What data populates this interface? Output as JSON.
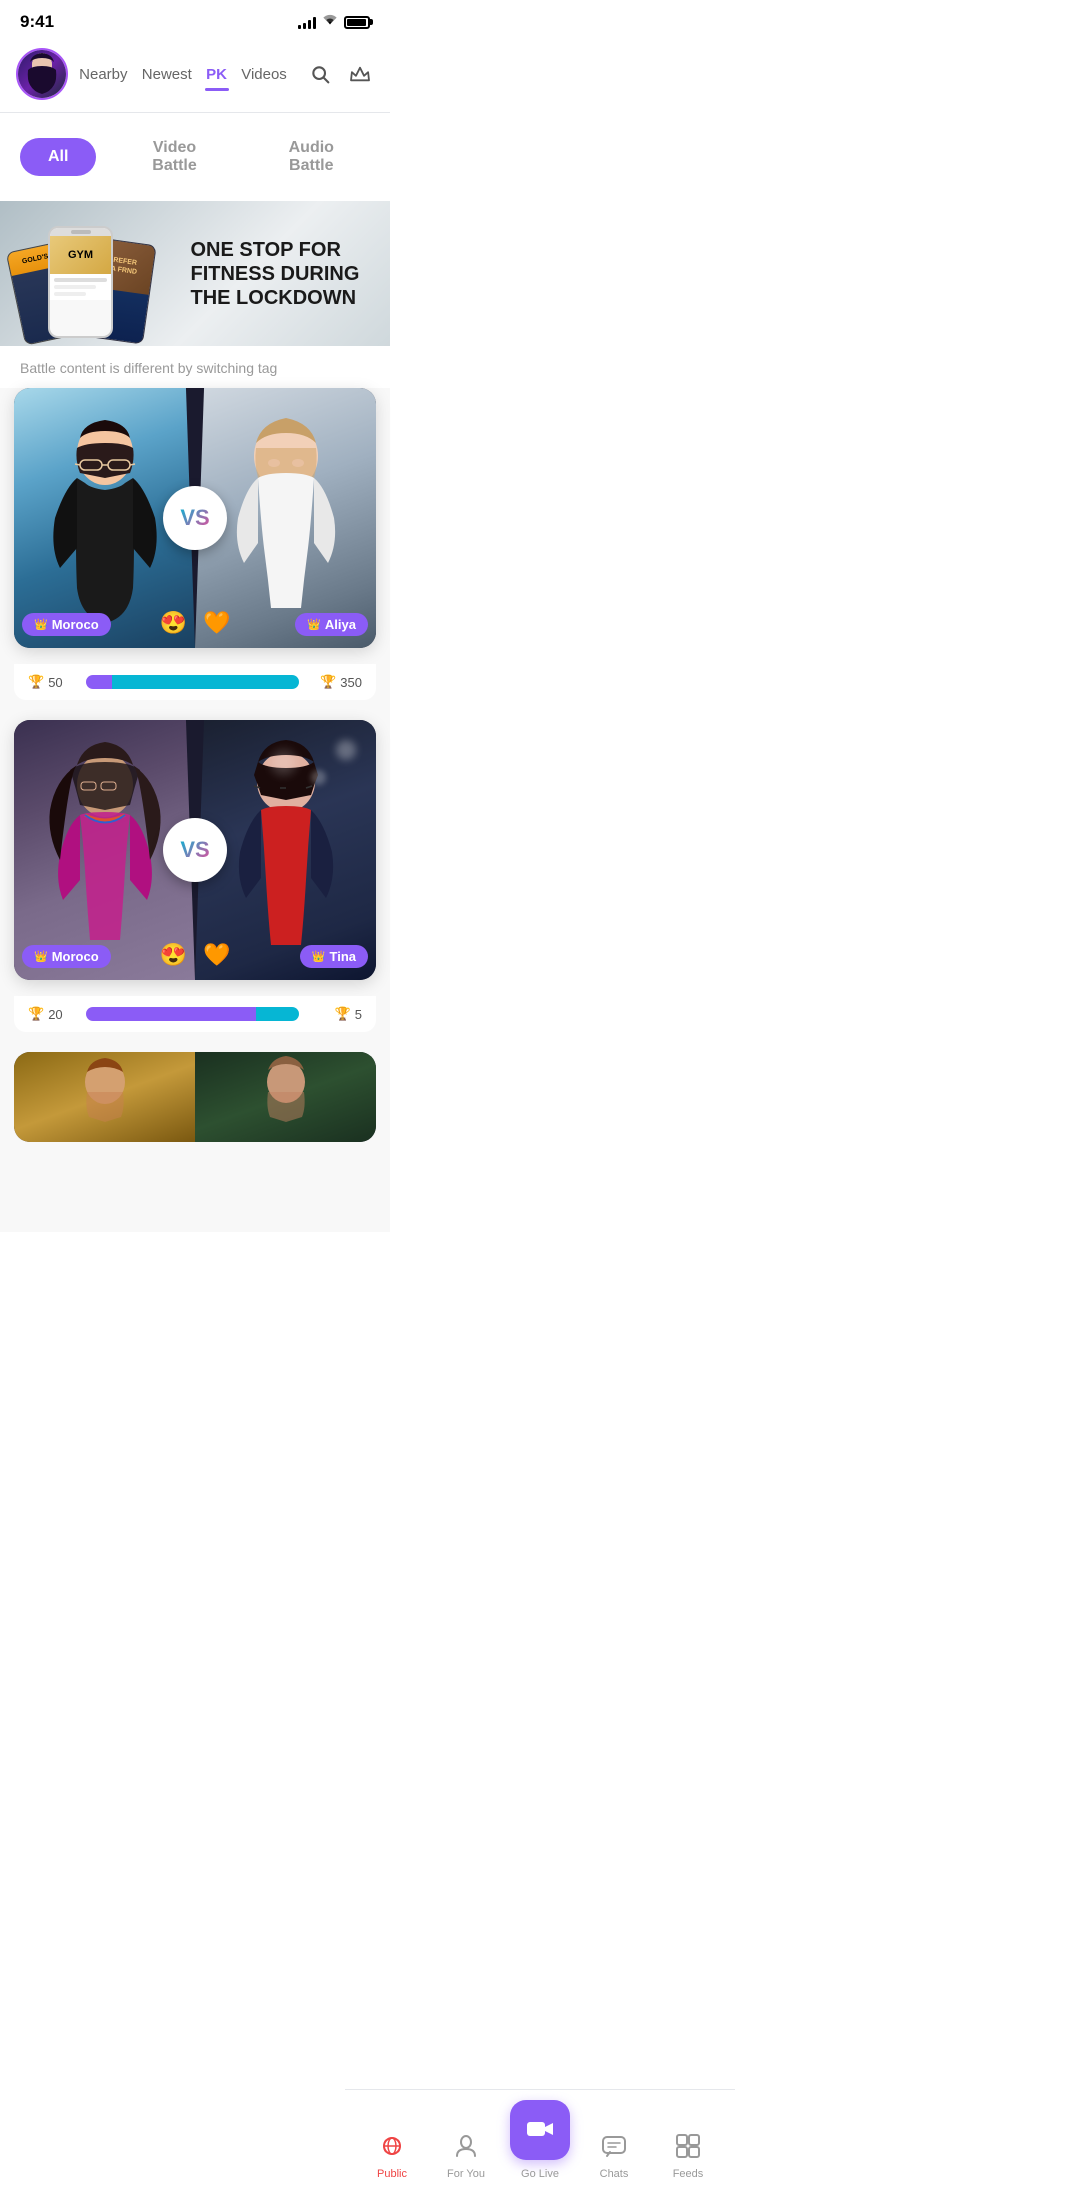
{
  "statusBar": {
    "time": "9:41",
    "signal": "4 bars",
    "wifi": "wifi",
    "battery": "full"
  },
  "header": {
    "nearbyLabel": "Nearby",
    "newestLabel": "Newest",
    "pkLabel": "PK",
    "videosLabel": "Videos",
    "activeTab": "PK"
  },
  "filterBar": {
    "allLabel": "All",
    "videoBattleLabel": "Video Battle",
    "audioBattleLabel": "Audio Battle",
    "activeFilter": "All"
  },
  "banner": {
    "title": "ONE STOP FOR FITNESS DURING THE LOCKDOWN"
  },
  "subtitle": "Battle content is different by switching tag",
  "battles": [
    {
      "leftName": "Moroco",
      "rightName": "Aliya",
      "leftEmoji": "😍",
      "rightEmoji": "🧡",
      "leftScore": 50,
      "rightScore": 350,
      "leftPercent": 12,
      "rightPercent": 88
    },
    {
      "leftName": "Moroco",
      "rightName": "Tina",
      "leftEmoji": "😍",
      "rightEmoji": "🧡",
      "leftScore": 20,
      "rightScore": 5,
      "leftPercent": 80,
      "rightPercent": 20
    }
  ],
  "bottomNav": {
    "publicLabel": "Public",
    "forYouLabel": "For You",
    "goLiveLabel": "Go Live",
    "chatsLabel": "Chats",
    "feedsLabel": "Feeds"
  }
}
